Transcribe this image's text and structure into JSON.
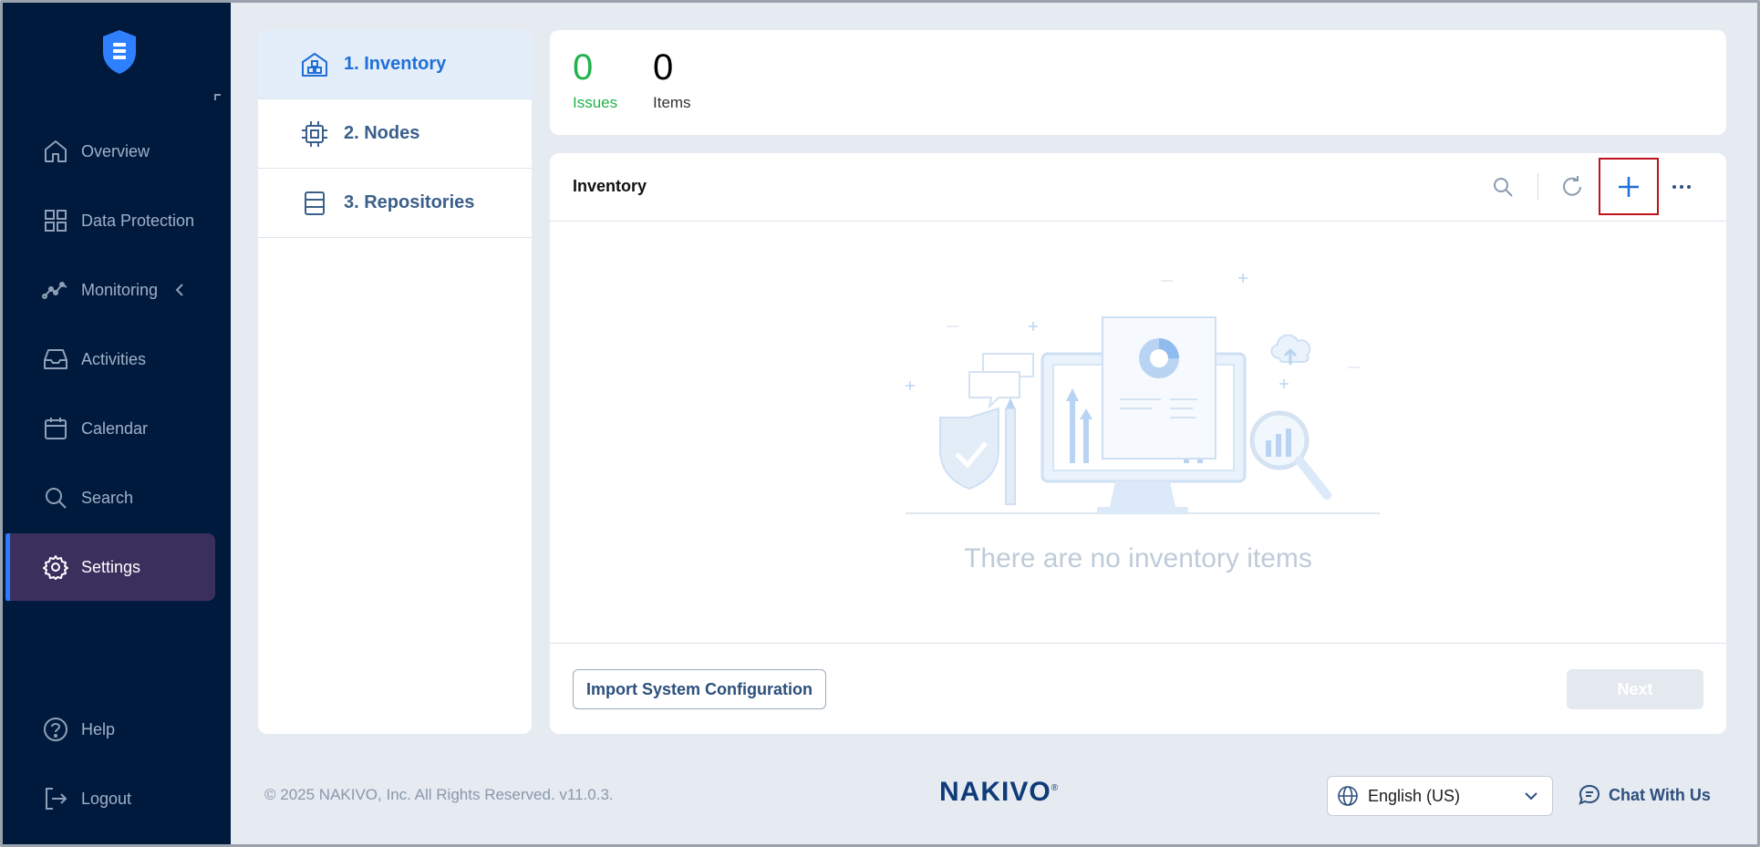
{
  "sidebar": {
    "items": [
      {
        "label": "Overview",
        "icon": "home-icon"
      },
      {
        "label": "Data Protection",
        "icon": "grid-icon"
      },
      {
        "label": "Monitoring",
        "icon": "monitoring-icon"
      },
      {
        "label": "Activities",
        "icon": "inbox-icon"
      },
      {
        "label": "Calendar",
        "icon": "calendar-icon"
      },
      {
        "label": "Search",
        "icon": "search-icon"
      },
      {
        "label": "Settings",
        "icon": "gear-icon",
        "active": true
      }
    ],
    "bottom": [
      {
        "label": "Help",
        "icon": "help-icon"
      },
      {
        "label": "Logout",
        "icon": "logout-icon"
      }
    ]
  },
  "steps": [
    {
      "label": "1. Inventory",
      "icon": "inventory-icon",
      "active": true
    },
    {
      "label": "2. Nodes",
      "icon": "chip-icon"
    },
    {
      "label": "3. Repositories",
      "icon": "repository-icon"
    }
  ],
  "summary": {
    "issues": {
      "count": "0",
      "label": "Issues"
    },
    "items": {
      "count": "0",
      "label": "Items"
    }
  },
  "main": {
    "title": "Inventory",
    "empty_text": "There are no inventory items",
    "import_label": "Import System Configuration",
    "next_label": "Next"
  },
  "footer": {
    "copyright": "© 2025 NAKIVO, Inc. All Rights Reserved. v11.0.3.",
    "brand": "NAKIVO",
    "language": "English (US)",
    "chat_label": "Chat With Us"
  },
  "colors": {
    "sidebar_bg": "#001a3d",
    "accent": "#1f6fd6",
    "issues_green": "#22b24c",
    "highlight_red": "#c0141c"
  }
}
